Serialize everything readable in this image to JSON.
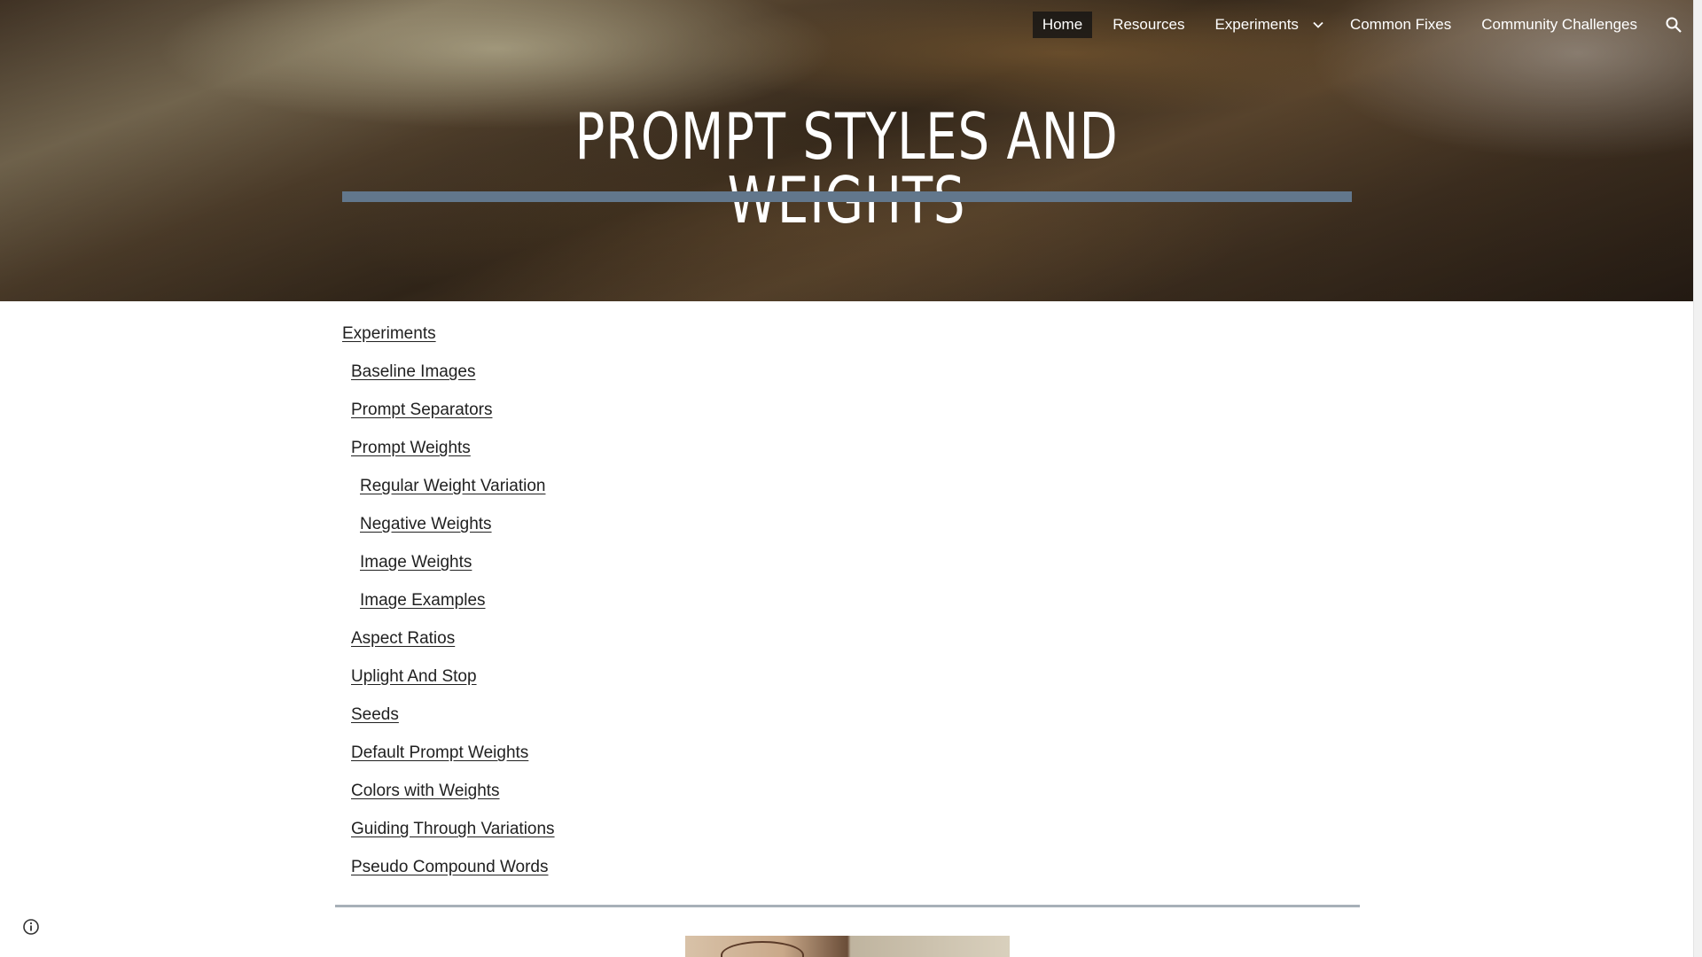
{
  "header": {
    "nav": {
      "items": [
        "Home",
        "Resources",
        "Experiments",
        "Common Fixes",
        "Community Challenges"
      ],
      "active": "Home",
      "dropdown_icon": "chevron-down-icon",
      "search_icon": "search-icon"
    },
    "title": "PROMPT STYLES AND WEIGHTS",
    "accent_color": "#62778c"
  },
  "toc": {
    "items": [
      {
        "label": "Experiments",
        "level": 0
      },
      {
        "label": "Baseline Images",
        "level": 1
      },
      {
        "label": "Prompt Separators",
        "level": 1
      },
      {
        "label": "Prompt Weights",
        "level": 1
      },
      {
        "label": "Regular Weight Variation",
        "level": 2
      },
      {
        "label": "Negative Weights",
        "level": 2
      },
      {
        "label": "Image Weights",
        "level": 2
      },
      {
        "label": "Image Examples",
        "level": 2
      },
      {
        "label": "Aspect Ratios",
        "level": 1
      },
      {
        "label": "Uplight And Stop",
        "level": 1
      },
      {
        "label": "Seeds",
        "level": 1
      },
      {
        "label": "Default Prompt Weights",
        "level": 1
      },
      {
        "label": "Colors with Weights",
        "level": 1
      },
      {
        "label": "Guiding Through Variations",
        "level": 1
      },
      {
        "label": "Pseudo Compound Words",
        "level": 1
      }
    ]
  },
  "footer": {
    "info_icon": "info-icon"
  }
}
